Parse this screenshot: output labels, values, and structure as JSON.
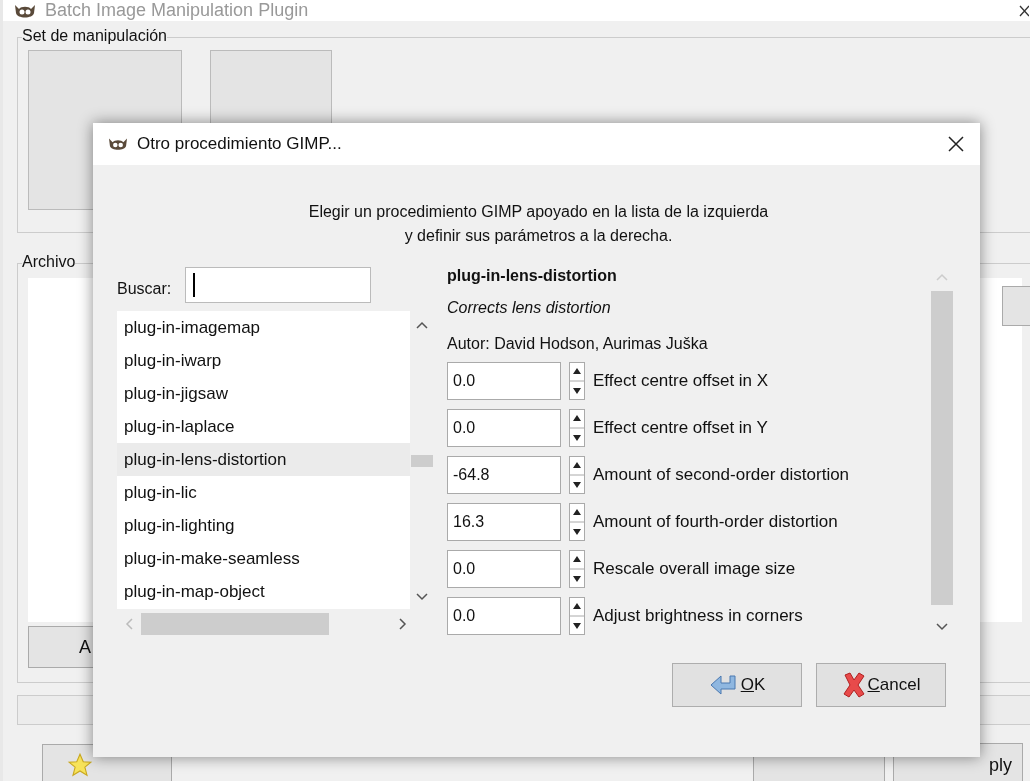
{
  "main_window": {
    "title": "Batch Image Manipulation Plugin",
    "manipulation_frame": {
      "label": "Set de manipulación"
    },
    "files_frame": {
      "label": "Archivo",
      "add_button": "A"
    },
    "apply_button": "ply"
  },
  "dialog": {
    "title": "Otro procedimiento GIMP...",
    "instructions": [
      "Elegir un procedimiento GIMP apoyado en la lista de la izquierda",
      "y definir sus parámetros a la derecha."
    ],
    "search": {
      "label": "Buscar:"
    },
    "procedures": [
      {
        "name": "plug-in-imagemap",
        "selected": false
      },
      {
        "name": "plug-in-iwarp",
        "selected": false
      },
      {
        "name": "plug-in-jigsaw",
        "selected": false
      },
      {
        "name": "plug-in-laplace",
        "selected": false
      },
      {
        "name": "plug-in-lens-distortion",
        "selected": true
      },
      {
        "name": "plug-in-lic",
        "selected": false
      },
      {
        "name": "plug-in-lighting",
        "selected": false
      },
      {
        "name": "plug-in-make-seamless",
        "selected": false
      },
      {
        "name": "plug-in-map-object",
        "selected": false
      }
    ],
    "procedure": {
      "name": "plug-in-lens-distortion",
      "description": "Corrects lens distortion",
      "author": "Autor: David Hodson, Aurimas Juška"
    },
    "params": [
      {
        "value": "0.0",
        "label": "Effect centre offset in X"
      },
      {
        "value": "0.0",
        "label": "Effect centre offset in Y"
      },
      {
        "value": "-64.8",
        "label": "Amount of second-order distortion"
      },
      {
        "value": "16.3",
        "label": "Amount of fourth-order distortion"
      },
      {
        "value": "0.0",
        "label": "Rescale overall image size"
      },
      {
        "value": "0.0",
        "label": "Adjust brightness in corners"
      }
    ],
    "buttons": [
      {
        "label": "OK",
        "kind": "ok"
      },
      {
        "label": "Cancel",
        "kind": "cancel"
      }
    ]
  }
}
